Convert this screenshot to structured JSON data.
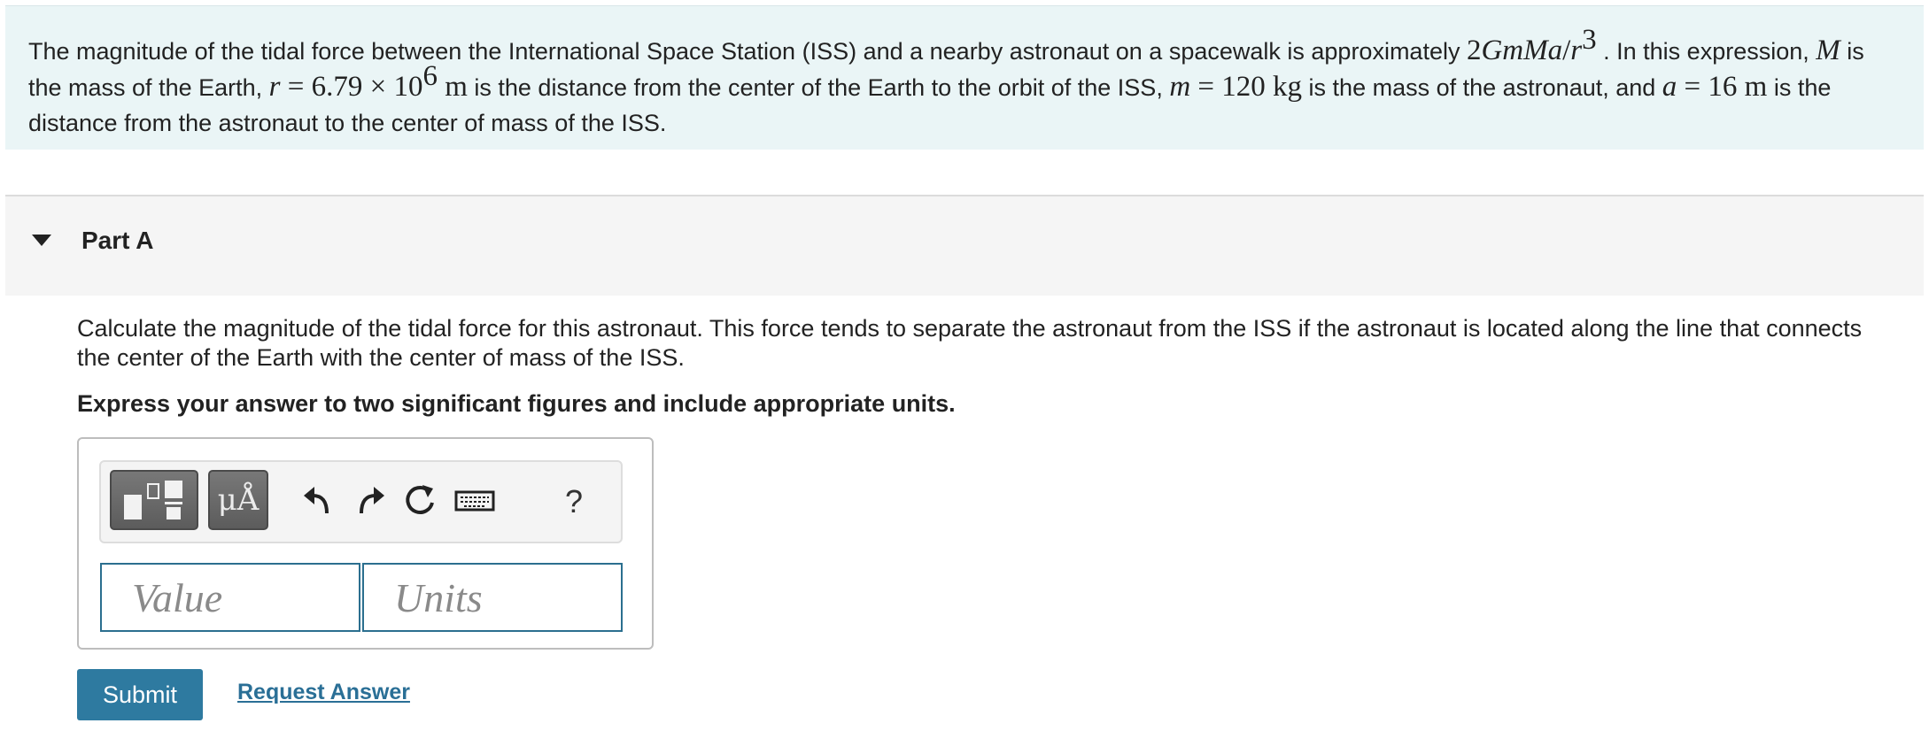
{
  "intro": {
    "t1": "The magnitude of the tidal force between the International Space Station (ISS) and a nearby astronaut on a spacewalk is approximately ",
    "expr_coef": "2",
    "expr_vars": "GmMa",
    "expr_slash": "/",
    "expr_r": "r",
    "expr_exp": "3",
    "t2": " . In this expression, ",
    "var_M": "M",
    "t3": " is the mass of the Earth, ",
    "var_r": "r",
    "r_eq": " = 6.79 × 10",
    "r_exp": "6",
    "r_unit": " m",
    "t4": " is the distance from the center of the Earth to the orbit of the ISS, ",
    "var_m": "m",
    "m_eq": " = 120 kg",
    "t5": " is the mass of the astronaut, and ",
    "var_a": "a",
    "a_eq": " = 16 m",
    "t6": " is the distance from the astronaut to the center of mass of the ISS."
  },
  "partA": {
    "title": "Part A",
    "question": "Calculate the magnitude of the tidal force for this astronaut. This force tends to separate the astronaut from the ISS if the astronaut is located along the line that connects the center of the Earth with the center of mass of the ISS.",
    "instruction": "Express your answer to two significant figures and include appropriate units."
  },
  "toolbar": {
    "units_label": "μÅ",
    "help_label": "?",
    "icons": [
      "templates-icon",
      "units-icon",
      "undo-icon",
      "redo-icon",
      "reset-icon",
      "keyboard-icon",
      "help-icon"
    ]
  },
  "answer": {
    "value_placeholder": "Value",
    "units_placeholder": "Units"
  },
  "actions": {
    "submit_label": "Submit",
    "request_label": "Request Answer"
  },
  "colors": {
    "intro_bg": "#eaf5f6",
    "field_border": "#2b6f8f",
    "submit_bg": "#2e7aa0",
    "link": "#2a6f96"
  }
}
